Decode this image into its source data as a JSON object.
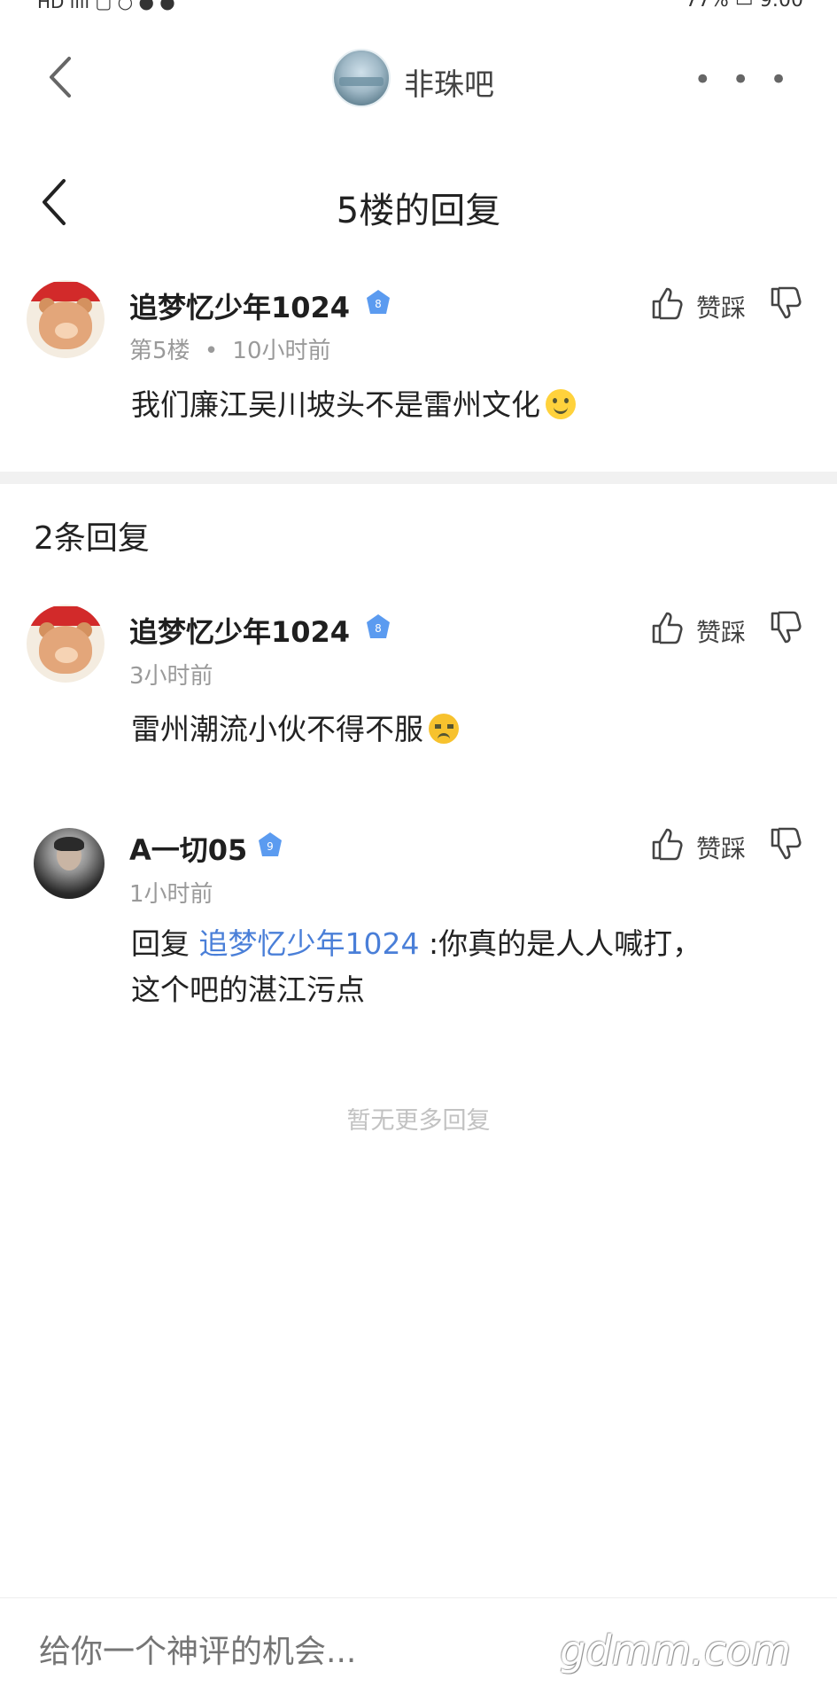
{
  "status_bar": {
    "left": "HD ıllı ▢ ○ ● ●",
    "right": "77% ▭ 9:00"
  },
  "top_bar": {
    "forum_name": "非珠吧",
    "more_label": "• • •"
  },
  "sub_header": {
    "title": "5楼的回复"
  },
  "main_comment": {
    "username": "追梦忆少年1024",
    "level": "8",
    "floor": "第5楼",
    "dot": "•",
    "time": "10小时前",
    "text": "我们廉江吴川坡头不是雷州文化",
    "vote_label": "赞踩"
  },
  "reply_count": "2条回复",
  "replies": [
    {
      "username": "追梦忆少年1024",
      "level": "8",
      "time": "3小时前",
      "text": "雷州潮流小伙不得不服",
      "vote_label": "赞踩"
    },
    {
      "username": "A一切05",
      "level": "9",
      "time": "1小时前",
      "reply_prefix": "回复",
      "mention": "追梦忆少年1024",
      "text_line1": " :你真的是人人喊打，",
      "text_line2": "这个吧的湛江污点",
      "vote_label": "赞踩"
    }
  ],
  "no_more": "暂无更多回复",
  "bottom": {
    "placeholder": "给你一个神评的机会...",
    "watermark": "gdmm.com"
  },
  "colors": {
    "mention": "#4a7fd8",
    "level_badge": "#5b9bf0",
    "divider": "#f1f1f1"
  }
}
